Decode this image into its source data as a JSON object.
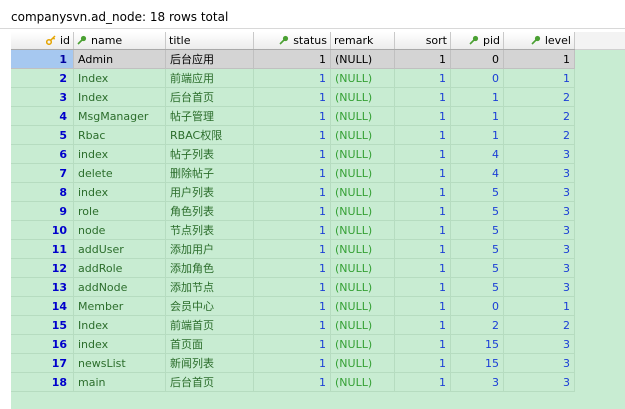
{
  "title": "companysvn.ad_node: 18 rows total",
  "columns": [
    {
      "key": "id",
      "label": "id",
      "icon": "key-icon",
      "align": "right"
    },
    {
      "key": "name",
      "label": "name",
      "icon": "pin-icon",
      "align": "left"
    },
    {
      "key": "title",
      "label": "title",
      "icon": "",
      "align": "left"
    },
    {
      "key": "status",
      "label": "status",
      "icon": "pin-icon",
      "align": "right"
    },
    {
      "key": "remark",
      "label": "remark",
      "icon": "",
      "align": "left"
    },
    {
      "key": "sort",
      "label": "sort",
      "icon": "",
      "align": "right"
    },
    {
      "key": "pid",
      "label": "pid",
      "icon": "pin-icon",
      "align": "right"
    },
    {
      "key": "level",
      "label": "level",
      "icon": "pin-icon",
      "align": "right"
    }
  ],
  "rows": [
    {
      "id": "1",
      "name": "Admin",
      "title": "后台应用",
      "status": "1",
      "remark": "(NULL)",
      "sort": "1",
      "pid": "0",
      "level": "1"
    },
    {
      "id": "2",
      "name": "Index",
      "title": "前端应用",
      "status": "1",
      "remark": "(NULL)",
      "sort": "1",
      "pid": "0",
      "level": "1"
    },
    {
      "id": "3",
      "name": "Index",
      "title": "后台首页",
      "status": "1",
      "remark": "(NULL)",
      "sort": "1",
      "pid": "1",
      "level": "2"
    },
    {
      "id": "4",
      "name": "MsgManager",
      "title": "帖子管理",
      "status": "1",
      "remark": "(NULL)",
      "sort": "1",
      "pid": "1",
      "level": "2"
    },
    {
      "id": "5",
      "name": "Rbac",
      "title": "RBAC权限",
      "status": "1",
      "remark": "(NULL)",
      "sort": "1",
      "pid": "1",
      "level": "2"
    },
    {
      "id": "6",
      "name": "index",
      "title": "帖子列表",
      "status": "1",
      "remark": "(NULL)",
      "sort": "1",
      "pid": "4",
      "level": "3"
    },
    {
      "id": "7",
      "name": "delete",
      "title": "删除帖子",
      "status": "1",
      "remark": "(NULL)",
      "sort": "1",
      "pid": "4",
      "level": "3"
    },
    {
      "id": "8",
      "name": "index",
      "title": "用户列表",
      "status": "1",
      "remark": "(NULL)",
      "sort": "1",
      "pid": "5",
      "level": "3"
    },
    {
      "id": "9",
      "name": "role",
      "title": "角色列表",
      "status": "1",
      "remark": "(NULL)",
      "sort": "1",
      "pid": "5",
      "level": "3"
    },
    {
      "id": "10",
      "name": "node",
      "title": "节点列表",
      "status": "1",
      "remark": "(NULL)",
      "sort": "1",
      "pid": "5",
      "level": "3"
    },
    {
      "id": "11",
      "name": "addUser",
      "title": "添加用户",
      "status": "1",
      "remark": "(NULL)",
      "sort": "1",
      "pid": "5",
      "level": "3"
    },
    {
      "id": "12",
      "name": "addRole",
      "title": "添加角色",
      "status": "1",
      "remark": "(NULL)",
      "sort": "1",
      "pid": "5",
      "level": "3"
    },
    {
      "id": "13",
      "name": "addNode",
      "title": "添加节点",
      "status": "1",
      "remark": "(NULL)",
      "sort": "1",
      "pid": "5",
      "level": "3"
    },
    {
      "id": "14",
      "name": "Member",
      "title": "会员中心",
      "status": "1",
      "remark": "(NULL)",
      "sort": "1",
      "pid": "0",
      "level": "1"
    },
    {
      "id": "15",
      "name": "Index",
      "title": "前端首页",
      "status": "1",
      "remark": "(NULL)",
      "sort": "1",
      "pid": "2",
      "level": "2"
    },
    {
      "id": "16",
      "name": "index",
      "title": "首页面",
      "status": "1",
      "remark": "(NULL)",
      "sort": "1",
      "pid": "15",
      "level": "3"
    },
    {
      "id": "17",
      "name": "newsList",
      "title": "新闻列表",
      "status": "1",
      "remark": "(NULL)",
      "sort": "1",
      "pid": "15",
      "level": "3"
    },
    {
      "id": "18",
      "name": "main",
      "title": "后台首页",
      "status": "1",
      "remark": "(NULL)",
      "sort": "1",
      "pid": "3",
      "level": "3"
    }
  ],
  "selected_row": 0,
  "colors": {
    "grid_bg": "#c8ecd2",
    "selected_row": "#d4d4d4",
    "selected_id": "#a6c8f0",
    "id_text": "#0000cc",
    "number_text": "#1a3ed6",
    "text_text": "#2b6d2b",
    "null_text": "#35a035",
    "key_icon": "#e5a400",
    "pin_icon": "#4aa032"
  }
}
